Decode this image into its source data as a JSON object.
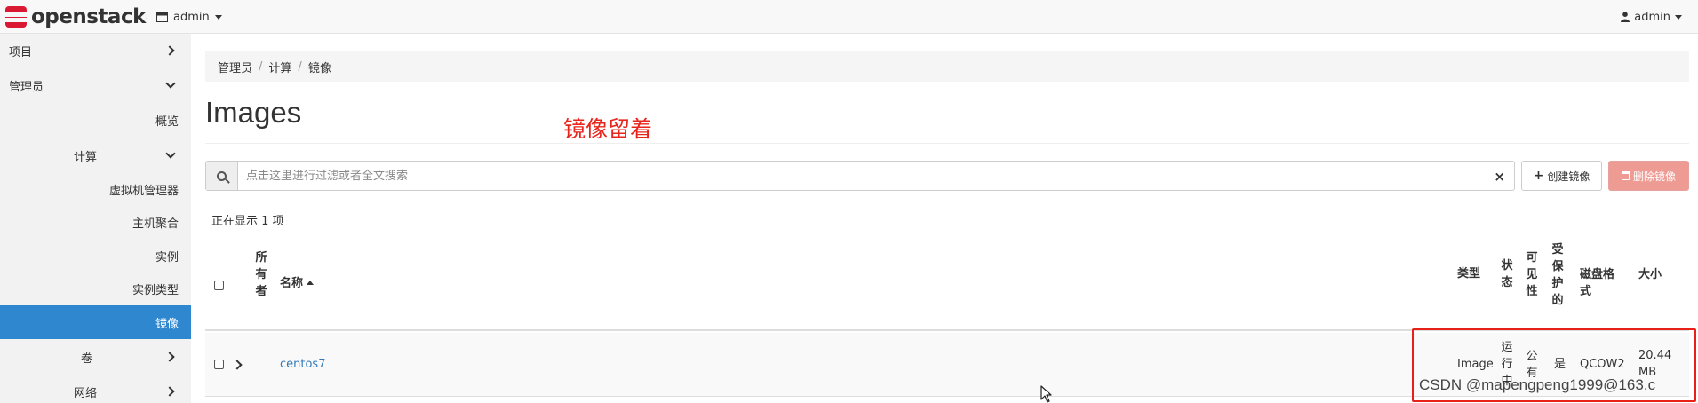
{
  "topbar": {
    "logo_text": "openstack",
    "project_dropdown": "admin",
    "user_dropdown": "admin"
  },
  "sidebar": {
    "items": [
      {
        "label": "项目",
        "chevron": "right"
      },
      {
        "label": "管理员",
        "chevron": "down"
      },
      {
        "label": "概览"
      },
      {
        "label": "计算",
        "chevron": "down"
      },
      {
        "label": "虚拟机管理器"
      },
      {
        "label": "主机聚合"
      },
      {
        "label": "实例"
      },
      {
        "label": "实例类型"
      },
      {
        "label": "镜像",
        "active": true
      },
      {
        "label": "卷",
        "chevron": "right"
      },
      {
        "label": "网络",
        "chevron": "right"
      }
    ]
  },
  "breadcrumb": [
    "管理员",
    "计算",
    "镜像"
  ],
  "page": {
    "title": "Images",
    "annotation": "镜像留着"
  },
  "filter": {
    "placeholder": "点击这里进行过滤或者全文搜索",
    "clear": "×"
  },
  "actions": {
    "create": "创建镜像",
    "delete": "删除镜像"
  },
  "count_text": "正在显示 1 项",
  "table": {
    "headers": {
      "owner": "所有者",
      "name": "名称",
      "type": "类型",
      "status": "状态",
      "visibility": "可见性",
      "protected": "受保护的",
      "disk_format": "磁盘格式",
      "size": "大小"
    },
    "rows": [
      {
        "owner": "",
        "name": "centos7",
        "type": "Image",
        "status": "运行中",
        "visibility": "公有",
        "protected": "是",
        "disk_format": "QCOW2",
        "size": "20.44 MB"
      }
    ]
  },
  "watermark": "CSDN @mapengpeng1999@163.c",
  "colors": {
    "active_nav": "#2f87cf",
    "delete_button": "#ee9b93",
    "highlight_box": "#e8201a",
    "annotation": "#e8251c",
    "link": "#337ab7"
  }
}
